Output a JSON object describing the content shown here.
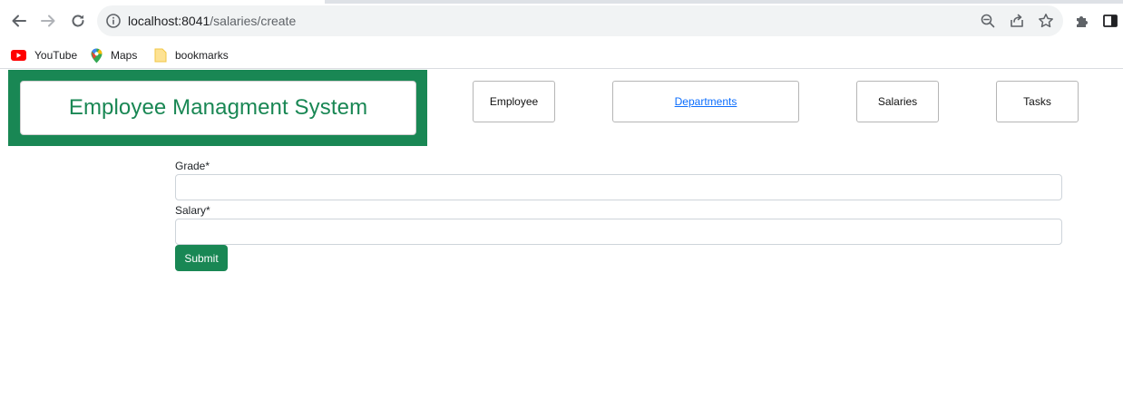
{
  "browser": {
    "url_host": "localhost:8041",
    "url_path": "/salaries/create",
    "bookmarks": [
      {
        "label": "YouTube",
        "icon": "youtube-icon"
      },
      {
        "label": "Maps",
        "icon": "maps-pin-icon"
      },
      {
        "label": "bookmarks",
        "icon": "folder-icon"
      }
    ]
  },
  "header": {
    "brand": "Employee Managment System",
    "nav": [
      {
        "label": "Employee"
      },
      {
        "label": "Departments"
      },
      {
        "label": "Salaries"
      },
      {
        "label": "Tasks"
      }
    ]
  },
  "form": {
    "grade_label": "Grade*",
    "grade_value": "",
    "salary_label": "Salary*",
    "salary_value": "",
    "submit_label": "Submit"
  },
  "colors": {
    "accent": "#198754",
    "link": "#0d6efd"
  }
}
